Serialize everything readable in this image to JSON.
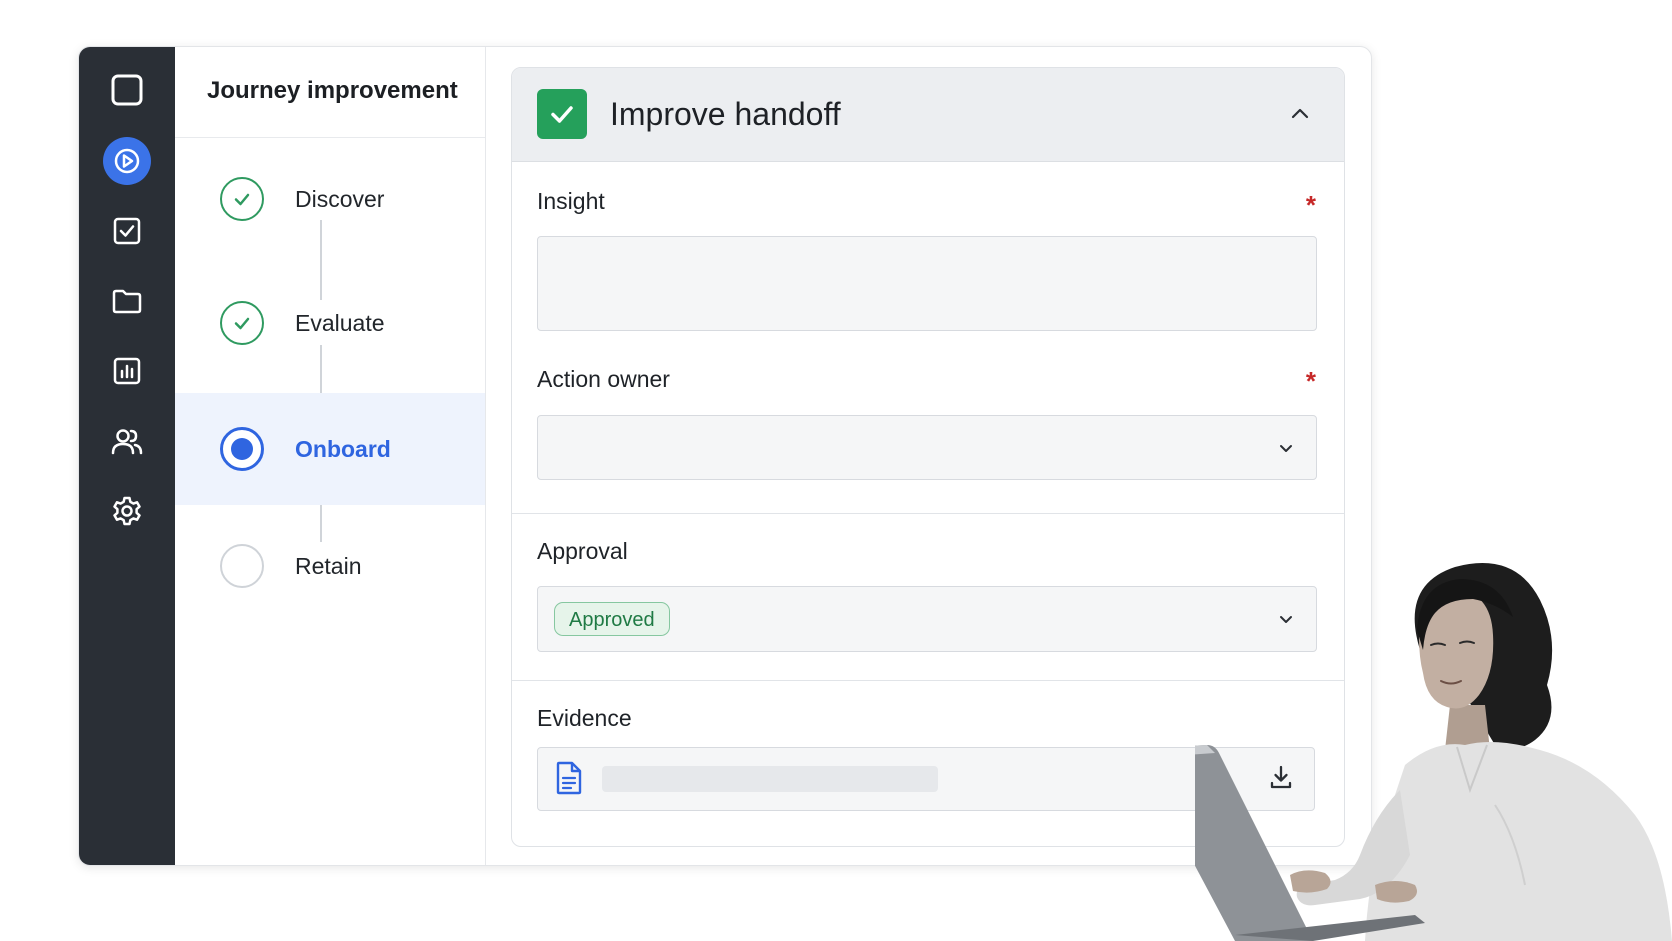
{
  "sidebar": {
    "items": [
      {
        "icon": "square-icon"
      },
      {
        "icon": "play-icon",
        "active": true
      },
      {
        "icon": "checkbox-icon"
      },
      {
        "icon": "folder-icon"
      },
      {
        "icon": "chart-icon"
      },
      {
        "icon": "users-icon"
      },
      {
        "icon": "gear-icon"
      }
    ]
  },
  "stepper": {
    "title": "Journey improvement",
    "steps": [
      {
        "label": "Discover",
        "status": "done"
      },
      {
        "label": "Evaluate",
        "status": "done"
      },
      {
        "label": "Onboard",
        "status": "current"
      },
      {
        "label": "Retain",
        "status": "todo"
      }
    ]
  },
  "panel": {
    "title": "Improve handoff",
    "insight": {
      "label": "Insight",
      "required_mark": "*",
      "value": ""
    },
    "action_owner": {
      "label": "Action owner",
      "required_mark": "*",
      "value": ""
    },
    "approval": {
      "label": "Approval",
      "value": "Approved"
    },
    "evidence": {
      "label": "Evidence"
    }
  },
  "colors": {
    "rail_bg": "#2a2f36",
    "accent_blue": "#2f65e0",
    "success_green": "#25a05b",
    "required_red": "#c62828"
  }
}
